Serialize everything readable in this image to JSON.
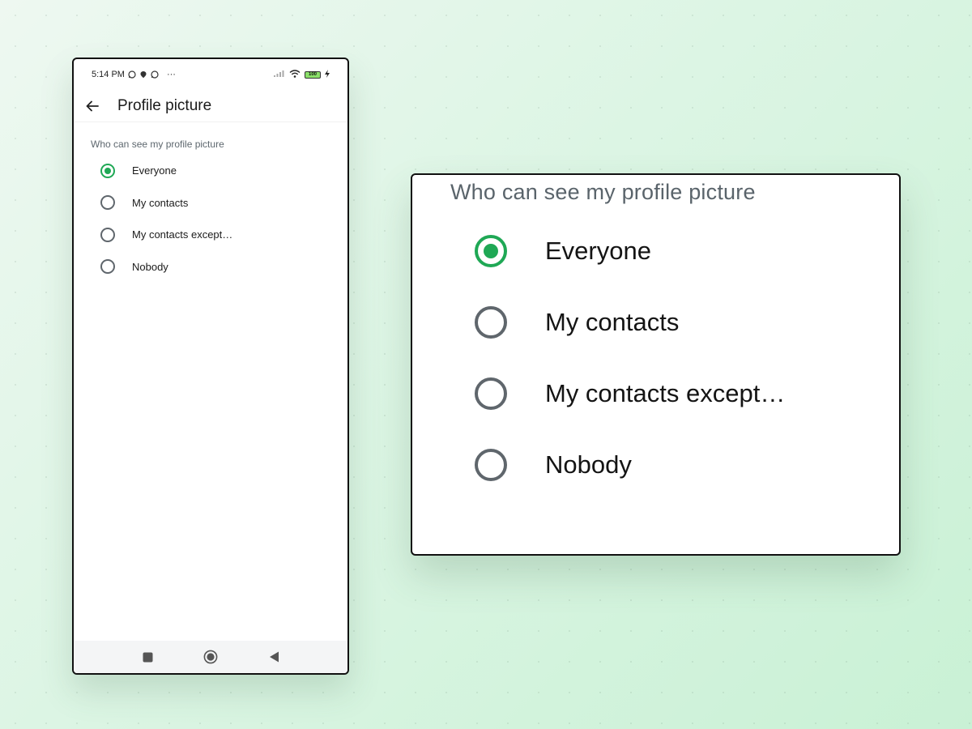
{
  "status_bar": {
    "time": "5:14 PM",
    "dots": "···",
    "battery": "100",
    "icons": [
      "whatsapp-icon",
      "location-icon",
      "whatsapp-icon",
      "signal-icon",
      "wifi-icon",
      "battery-icon",
      "charging-icon"
    ]
  },
  "app_bar": {
    "title": "Profile picture",
    "back_icon": "back-arrow-icon"
  },
  "section_label": "Who can see my profile picture",
  "options": [
    {
      "label": "Everyone",
      "selected": true
    },
    {
      "label": "My contacts",
      "selected": false
    },
    {
      "label": "My contacts except…",
      "selected": false
    },
    {
      "label": "Nobody",
      "selected": false
    }
  ],
  "nav_bar": {
    "icons": [
      "recents-square-icon",
      "home-circle-icon",
      "back-triangle-icon"
    ]
  },
  "zoom": {
    "section_label": "Who can see my profile picture",
    "options": [
      {
        "label": "Everyone",
        "selected": true
      },
      {
        "label": "My contacts",
        "selected": false
      },
      {
        "label": "My contacts except…",
        "selected": false
      },
      {
        "label": "Nobody",
        "selected": false
      }
    ]
  },
  "colors": {
    "accent": "#1fa855",
    "radio_off": "#5f666c",
    "label_gray": "#5a646b"
  }
}
